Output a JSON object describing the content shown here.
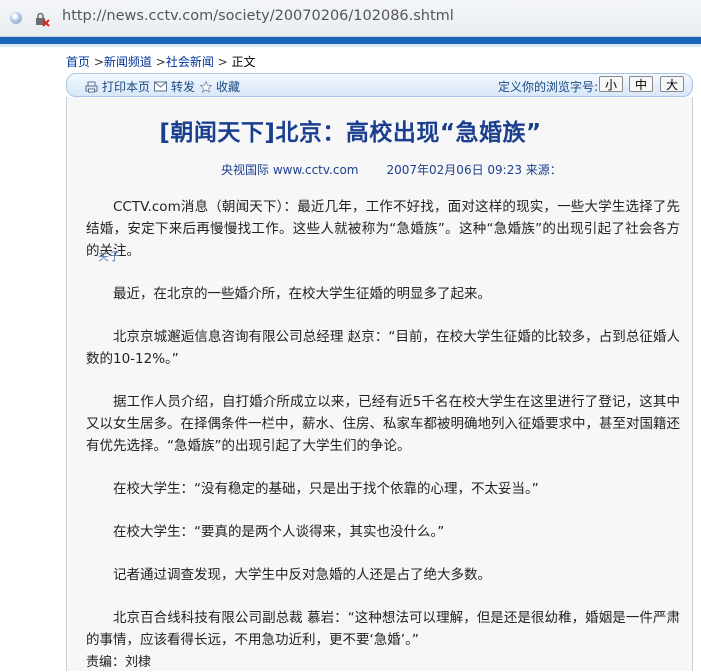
{
  "browser": {
    "url": "http://news.cctv.com/society/20070206/102086.shtml"
  },
  "breadcrumb": {
    "items": [
      "首页",
      "新闻频道",
      "社会新闻"
    ],
    "current": "正文",
    "separator": ">"
  },
  "toolbar": {
    "print": "打印本页",
    "forward": "转发",
    "favorite": "收藏",
    "font_size_label": "定义你的浏览字号:",
    "size_small": "小",
    "size_medium": "中",
    "size_large": "大"
  },
  "article": {
    "title": "[朝闻天下]北京：高校出现“急婚族”",
    "source": "央视国际 www.cctv.com",
    "date": "2007年02月06日 09:23 来源：",
    "paragraphs": [
      "CCTV.com消息（朝闻天下）：最近几年，工作不好找，面对这样的现实，一些大学生选择了先结婚，安定下来后再慢慢找工作。这些人就被称为“急婚族”。这种“急婚族”的出现引起了社会各方的关注。",
      "最近，在北京的一些婚介所，在校大学生征婚的明显多了起来。",
      "北京京城邂逅信息咨询有限公司总经理 赵京：“目前，在校大学生征婚的比较多，占到总征婚人数的10-12%。”",
      "据工作人员介绍，自打婚介所成立以来，已经有近5千名在校大学生在这里进行了登记，这其中又以女生居多。在择偶条件一栏中，薪水、住房、私家车都被明确地列入征婚要求中，甚至对国籍还有优先选择。“急婚族”的出现引起了大学生们的争论。",
      "在校大学生：“没有稳定的基础，只是出于找个依靠的心理，不太妥当。”",
      "在校大学生：“要真的是两个人谈得来，其实也没什么。”",
      "记者通过调查发现，大学生中反对急婚的人还是占了绝大多数。",
      "北京百合线科技有限公司副总裁 慕岩：“这种想法可以理解，但是还是很幼稚，婚姻是一件严肃的事情，应该看得长远，不用急功近利，更不要‘急婚’。”"
    ],
    "editor": "责编：刘棣",
    "stray_label": "关于"
  },
  "colors": {
    "site_blue": "#1a64b8",
    "title_blue": "#1b3f8f",
    "link_blue": "#003399"
  },
  "icons": [
    "globe-icon",
    "lock-error-icon",
    "print-icon",
    "mail-icon",
    "star-icon"
  ]
}
